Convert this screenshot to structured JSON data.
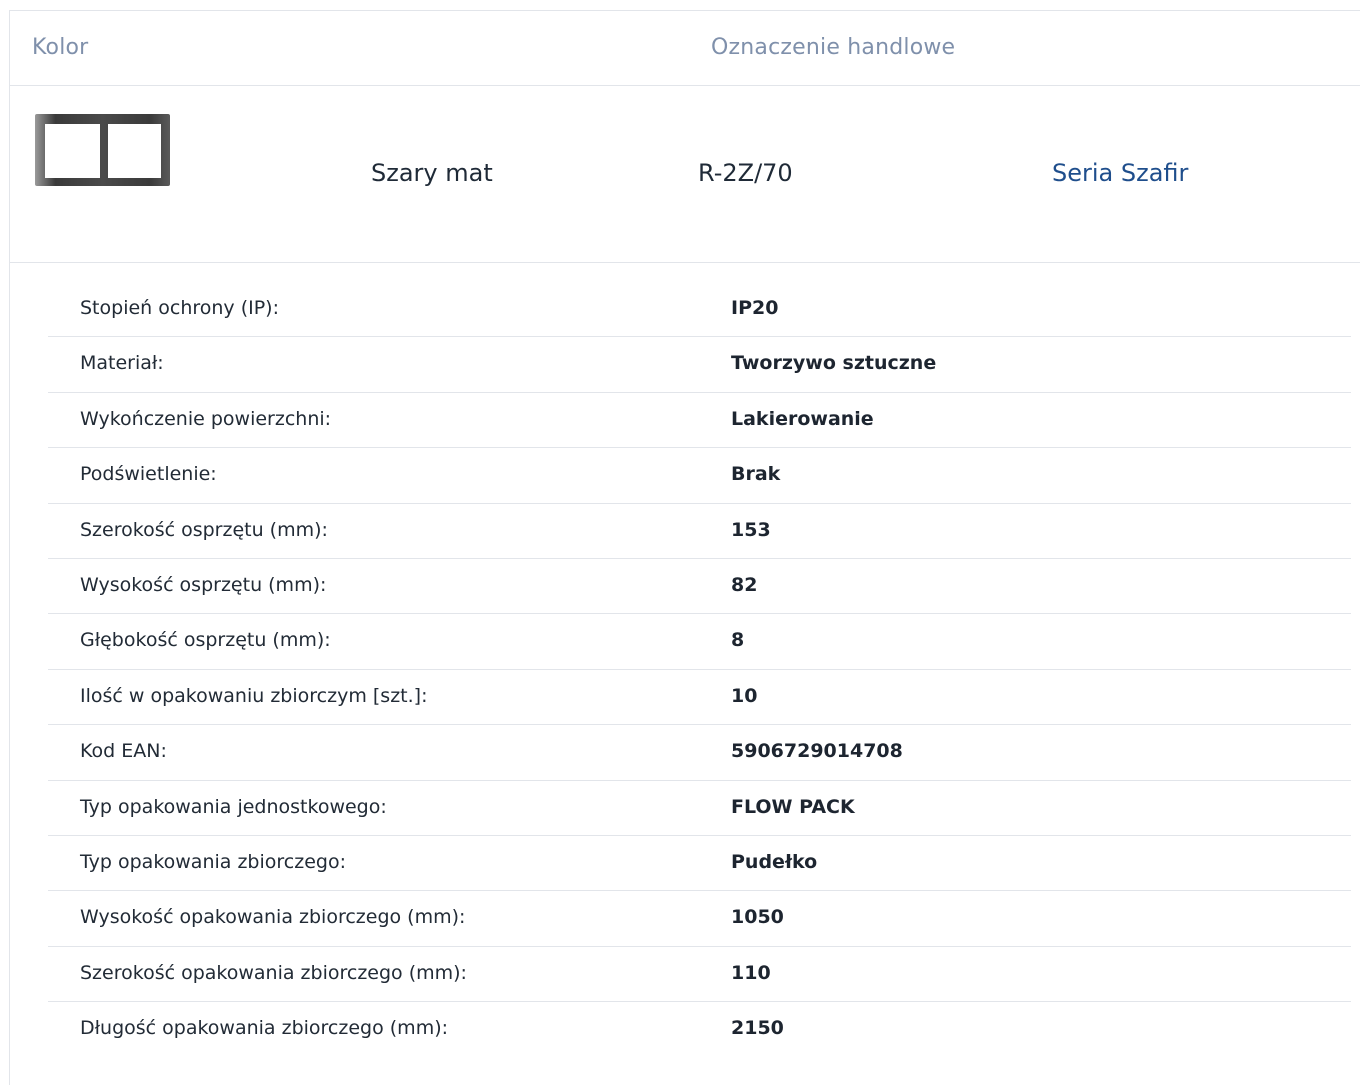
{
  "header": {
    "color_label": "Kolor",
    "trade_label": "Oznaczenie handlowe"
  },
  "product": {
    "thumbnail_icon": "double-frame-icon",
    "color_value": "Szary mat",
    "trade_value": "R-2Z/70",
    "series_link": "Seria Szafir"
  },
  "specs": [
    {
      "label": "Stopień ochrony (IP):",
      "value": "IP20"
    },
    {
      "label": "Materiał:",
      "value": "Tworzywo sztuczne"
    },
    {
      "label": "Wykończenie powierzchni:",
      "value": "Lakierowanie"
    },
    {
      "label": "Podświetlenie:",
      "value": "Brak"
    },
    {
      "label": "Szerokość osprzętu (mm):",
      "value": "153"
    },
    {
      "label": "Wysokość osprzętu (mm):",
      "value": "82"
    },
    {
      "label": "Głębokość osprzętu (mm):",
      "value": "8"
    },
    {
      "label": "Ilość w opakowaniu zbiorczym [szt.]:",
      "value": "10"
    },
    {
      "label": "Kod EAN:",
      "value": "5906729014708"
    },
    {
      "label": "Typ opakowania jednostkowego:",
      "value": "FLOW PACK"
    },
    {
      "label": "Typ opakowania zbiorczego:",
      "value": "Pudełko"
    },
    {
      "label": "Wysokość opakowania zbiorczego (mm):",
      "value": "1050"
    },
    {
      "label": "Szerokość opakowania zbiorczego (mm):",
      "value": "110"
    },
    {
      "label": "Długość opakowania zbiorczego (mm):",
      "value": "2150"
    }
  ],
  "colors": {
    "header_text": "#7f90ab",
    "link": "#1f4e8c",
    "border": "#e2e5ea"
  }
}
